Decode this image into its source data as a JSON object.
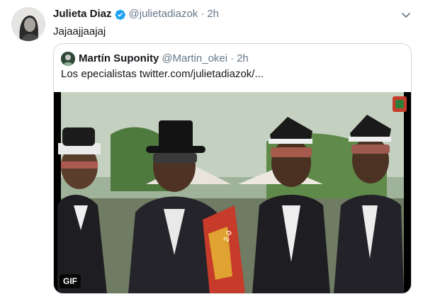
{
  "tweet": {
    "author": {
      "display_name": "Julieta Diaz",
      "handle": "@julietadiazok",
      "verified": true
    },
    "separator": "·",
    "time": "2h",
    "text": "Jajaajjaajaj",
    "icons": {
      "avatar": "profile-photo",
      "verified": "verified-badge-icon",
      "more": "chevron-down-icon"
    }
  },
  "quoted_tweet": {
    "author": {
      "display_name": "Martín Suponity",
      "handle": "@Martin_okei"
    },
    "separator": "·",
    "time": "2h",
    "text": "Los epecialistas  twitter.com/julietadiazok/...",
    "media": {
      "type": "gif",
      "badge": "GIF",
      "overlay_text": "2-0"
    }
  },
  "colors": {
    "text_primary": "#14171a",
    "text_secondary": "#657786",
    "verified_blue": "#1da1f2",
    "border": "#ccd6dd"
  }
}
